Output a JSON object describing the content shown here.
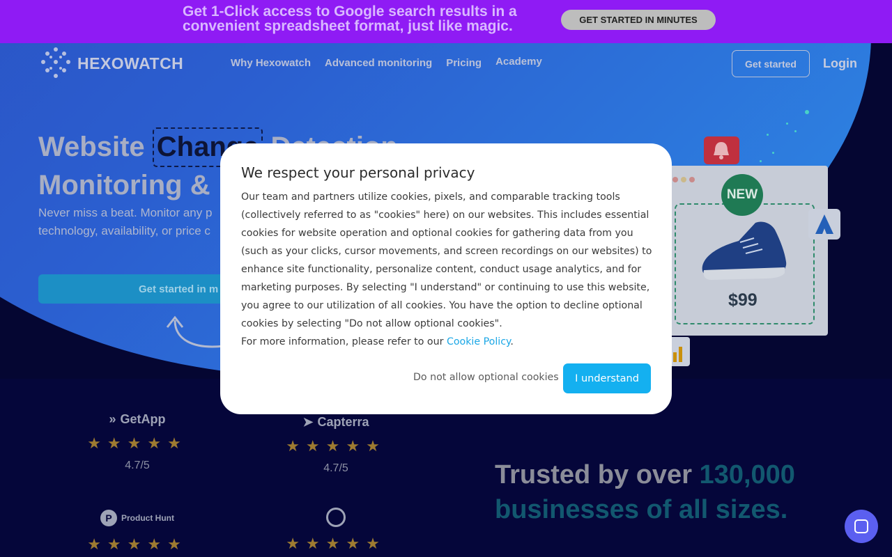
{
  "promo": {
    "text": "Get 1-Click access to Google search results in a convenient spreadsheet format, just like magic.",
    "button": "GET STARTED IN MINUTES"
  },
  "header": {
    "logo": "HEXOWATCH",
    "nav": [
      "Why Hexowatch",
      "Advanced monitoring",
      "Pricing",
      "Academy"
    ],
    "get_started": "Get started",
    "login": "Login"
  },
  "hero": {
    "title_part1": "Website ",
    "title_highlight": "Change",
    "title_part2": " Detection",
    "title_line2": "Monitoring & ",
    "subtitle_line1": "Never miss a beat. Monitor any p",
    "subtitle_line2": "technology, availability, or price c",
    "cta": "Get started in m"
  },
  "product_card": {
    "badge": "NEW",
    "price": "$99"
  },
  "ratings": [
    {
      "brand": "GetApp",
      "score": "4.7/5"
    },
    {
      "brand": "Capterra",
      "score": "4.7/5"
    },
    {
      "brand": "Product Hunt",
      "score": ""
    },
    {
      "brand": "",
      "score": ""
    }
  ],
  "trusted": {
    "part1": "Trusted by over ",
    "accent1": "130,000",
    "accent2": "businesses of all sizes."
  },
  "cookie_modal": {
    "title": "We respect your personal privacy",
    "body": "Our team and partners utilize cookies, pixels, and comparable tracking tools (collectively referred to as \"cookies\" here) on our websites. This includes essential cookies for website operation and optional cookies for gathering data from you (such as your clicks, cursor movements, and screen recordings on our websites) to enhance site functionality, personalize content, conduct usage analytics, and for marketing purposes. By selecting \"I understand\" or continuing to use this website, you agree to our utilization of all cookies. You have the option to decline optional cookies by selecting \"Do not allow optional cookies\".",
    "more_info": "For more information, please refer to our ",
    "policy_link": "Cookie Policy",
    "decline": "Do not allow optional cookies",
    "accept": "I understand"
  },
  "colors": {
    "promo_bg": "#8f1bf4",
    "accept": "#14b0f0",
    "link": "#1ba7e6"
  }
}
